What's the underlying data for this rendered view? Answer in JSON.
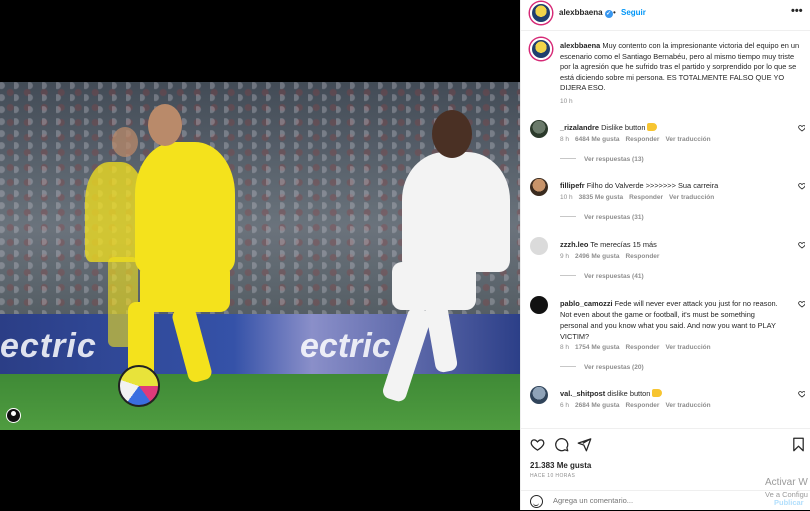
{
  "post": {
    "author": "alexbbaena",
    "follow_label": "Seguir",
    "separator": "•",
    "more_label": "•••",
    "verified_mark": "✓",
    "photo_ad_left": "ectric",
    "photo_ad_right": "ectric",
    "icon_names": [
      "user-tag-icon",
      "heart-icon",
      "comment-icon",
      "share-icon",
      "bookmark-icon",
      "more-icon",
      "emoji-icon"
    ],
    "colors": {
      "link": "#0095f6",
      "verified": "#3897f0",
      "muted": "#8e8e8e"
    }
  },
  "caption": {
    "user": "alexbbaena",
    "text": "Muy contento con la impresionante victoria del equipo en un escenario como el Santiago Bernabéu, pero al mismo tiempo muy triste por la agresión que he sufrido tras el partido y sorprendido por lo que se está diciendo sobre mi persona. ES TOTALMENTE FALSO QUE YO DIJERA ESO.",
    "time": "10 h"
  },
  "comments": [
    {
      "user": "_rizalandre",
      "text": "Dislike button",
      "time": "8 h",
      "likes": "6484 Me gusta",
      "reply": "Responder",
      "translate": "Ver traducción",
      "replies": "Ver respuestas (13)",
      "emoji": true
    },
    {
      "user": "fillipefr",
      "text": "Filho do Valverde >>>>>>> Sua carreira",
      "time": "10 h",
      "likes": "3835 Me gusta",
      "reply": "Responder",
      "translate": "Ver traducción",
      "replies": "Ver respuestas (31)",
      "emoji": false
    },
    {
      "user": "zzzh.leo",
      "text": "Te merecías 15 más",
      "time": "9 h",
      "likes": "2496 Me gusta",
      "reply": "Responder",
      "translate": "",
      "replies": "Ver respuestas (41)",
      "emoji": false
    },
    {
      "user": "pablo_camozzi",
      "text": "Fede will never ever attack you just for no reason. Not even about the game or football, it's must be something personal and you know what you said. And now you want to PLAY VICTIM?",
      "time": "8 h",
      "likes": "1754 Me gusta",
      "reply": "Responder",
      "translate": "Ver traducción",
      "replies": "Ver respuestas (20)",
      "emoji": false
    },
    {
      "user": "val._shitpost",
      "text": "dislike button",
      "time": "6 h",
      "likes": "2684 Me gusta",
      "reply": "Responder",
      "translate": "Ver traducción",
      "replies": "",
      "emoji": true
    }
  ],
  "actions": {
    "likes": "21.383 Me gusta",
    "ago": "HACE 10 HORAS",
    "add_comment_placeholder": "Agrega un comentario...",
    "publish": "Publicar"
  },
  "overlay": {
    "activate_line1": "Activar W",
    "activate_line2": "Ve a Configu"
  }
}
